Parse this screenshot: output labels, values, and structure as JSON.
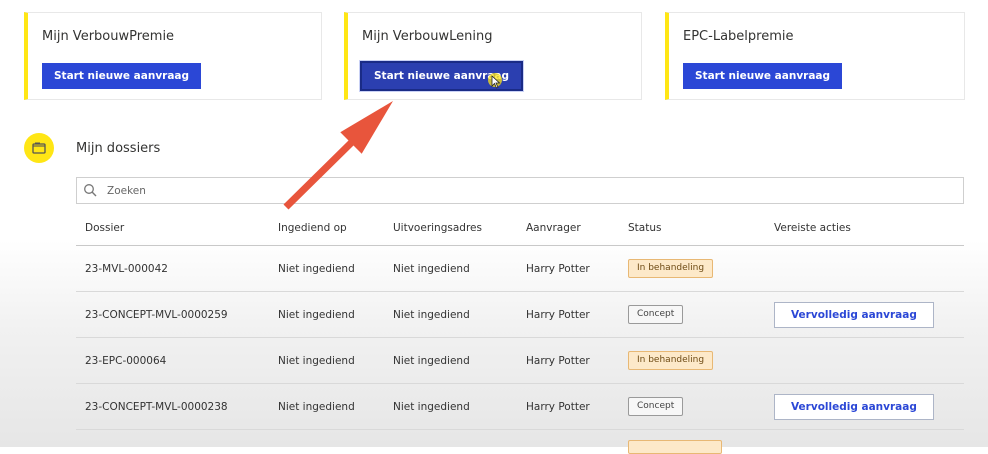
{
  "cards": [
    {
      "title": "Mijn VerbouwPremie",
      "button": "Start nieuwe aanvraag"
    },
    {
      "title": "Mijn VerbouwLening",
      "button": "Start nieuwe aanvraag"
    },
    {
      "title": "EPC-Labelpremie",
      "button": "Start nieuwe aanvraag"
    }
  ],
  "dossiers": {
    "title": "Mijn dossiers",
    "search_placeholder": "Zoeken",
    "columns": [
      "Dossier",
      "Ingediend op",
      "Uitvoeringsadres",
      "Aanvrager",
      "Status",
      "Vereiste acties"
    ],
    "rows": [
      {
        "dossier": "23-MVL-000042",
        "ingediend": "Niet ingediend",
        "adres": "Niet ingediend",
        "aanvrager": "Harry Potter",
        "status": "In behandeling",
        "actie": ""
      },
      {
        "dossier": "23-CONCEPT-MVL-0000259",
        "ingediend": "Niet ingediend",
        "adres": "Niet ingediend",
        "aanvrager": "Harry Potter",
        "status": "Concept",
        "actie": "Vervolledig aanvraag"
      },
      {
        "dossier": "23-EPC-000064",
        "ingediend": "Niet ingediend",
        "adres": "Niet ingediend",
        "aanvrager": "Harry Potter",
        "status": "In behandeling",
        "actie": ""
      },
      {
        "dossier": "23-CONCEPT-MVL-0000238",
        "ingediend": "Niet ingediend",
        "adres": "Niet ingediend",
        "aanvrager": "Harry Potter",
        "status": "Concept",
        "actie": "Vervolledig aanvraag"
      }
    ]
  },
  "colors": {
    "accent_yellow": "#ffe615",
    "button_blue": "#2b47d6",
    "annotation_arrow": "#e8553c",
    "badge_orange_bg": "#fde9c9"
  },
  "icons": {
    "section": "document-icon",
    "search": "search-icon"
  }
}
